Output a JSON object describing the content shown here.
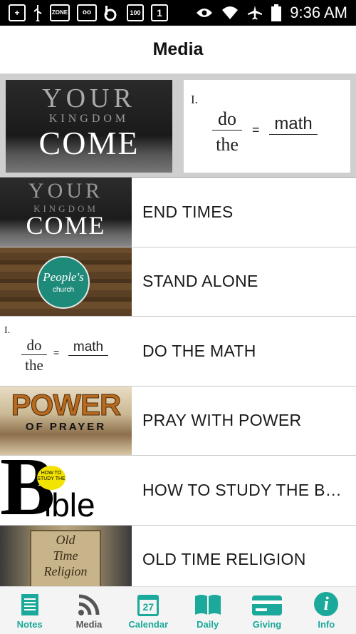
{
  "status_bar": {
    "time": "9:36 AM",
    "icons": [
      "plus-icon",
      "usb-icon",
      "zone-icon",
      "voicemail-icon",
      "beats-icon",
      "battery-100-icon",
      "sim-1-icon",
      "eye-icon",
      "wifi-icon",
      "airplane-icon",
      "battery-icon"
    ],
    "zone_text": "ZONE",
    "level_text": "100",
    "sim_text": "1"
  },
  "header": {
    "title": "Media"
  },
  "featured": {
    "image_lines": [
      "YOUR",
      "KINGDOM",
      "COME"
    ],
    "doc_numeral": "I.",
    "doc_top": "do",
    "doc_bottom": "the",
    "doc_eq": "=",
    "doc_word": "math"
  },
  "items": [
    {
      "label": "END TIMES",
      "thumb_lines": [
        "YOUR",
        "KINGDOM",
        "COME"
      ]
    },
    {
      "label": "STAND ALONE",
      "thumb_lines": [
        "People's",
        "church"
      ]
    },
    {
      "label": "DO THE MATH",
      "thumb_lines": [
        "I.",
        "do",
        "the",
        "=",
        "math"
      ]
    },
    {
      "label": "PRAY WITH POWER",
      "thumb_lines": [
        "POWER",
        "OF PRAYER"
      ]
    },
    {
      "label": "HOW TO STUDY THE BIB...",
      "thumb_lines": [
        "B",
        "ible",
        "HOW TO STUDY THE"
      ]
    },
    {
      "label": "OLD TIME RELIGION",
      "thumb_lines": [
        "Old",
        "Time",
        "Religion"
      ]
    }
  ],
  "tab_bar": {
    "tabs": [
      {
        "label": "Notes",
        "icon": "notes-icon"
      },
      {
        "label": "Media",
        "icon": "rss-icon"
      },
      {
        "label": "Calendar",
        "icon": "calendar-icon",
        "icon_text": "27"
      },
      {
        "label": "Daily",
        "icon": "book-icon"
      },
      {
        "label": "Giving",
        "icon": "card-icon"
      },
      {
        "label": "Info",
        "icon": "info-icon",
        "icon_text": "i"
      }
    ],
    "active_color": "#555555",
    "inactive_color": "#1aa99a"
  }
}
